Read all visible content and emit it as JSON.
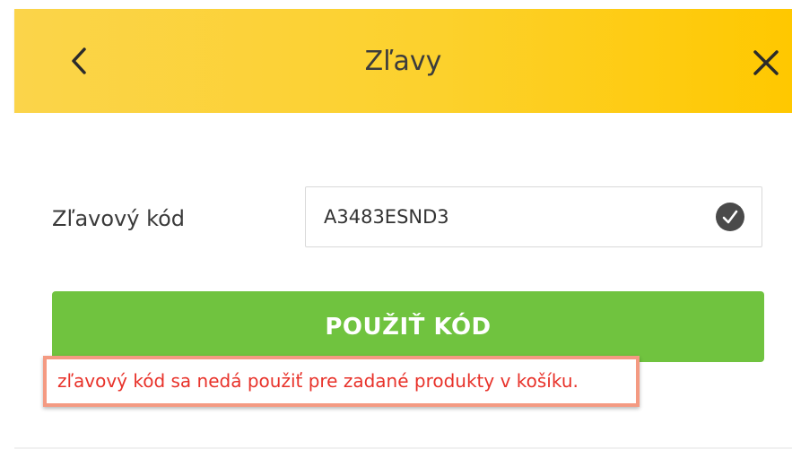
{
  "header": {
    "title": "Zľavy",
    "back_icon": "chevron-left-icon",
    "close_icon": "close-icon",
    "background": "#fcd12c"
  },
  "discount": {
    "label": "Zľavový kód",
    "code_value": "A3483ESND3",
    "code_valid_icon": "check-circle-icon",
    "apply_label": "POUŽIŤ KÓD",
    "apply_color": "#70c33f"
  },
  "error": {
    "message": "zľavový kód sa nedá použiť pre zadané produkty v košíku.",
    "text_color": "#e8322a",
    "highlight_color": "#f49a82"
  }
}
